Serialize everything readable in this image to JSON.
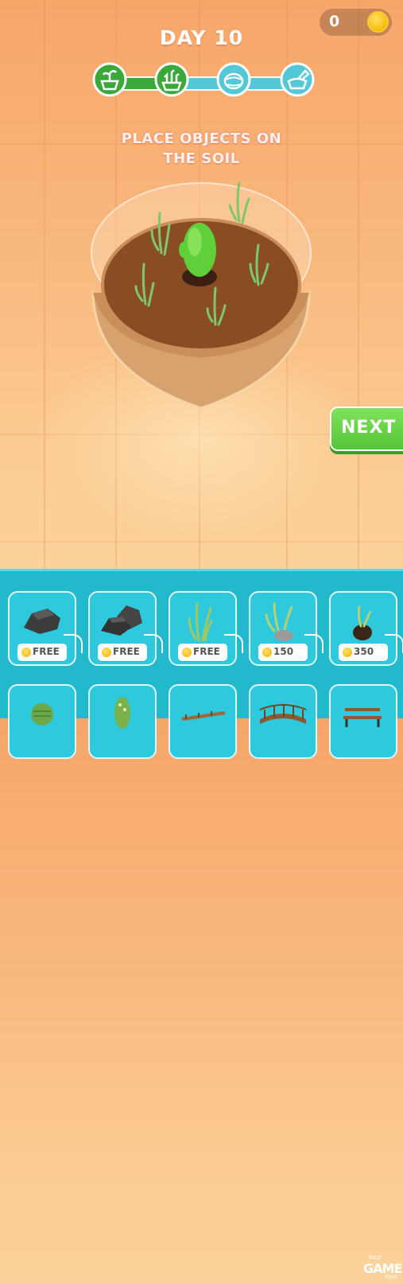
{
  "hud": {
    "coins": "0",
    "day_title": "DAY 10"
  },
  "progress": {
    "stages": [
      "plant-pot-icon",
      "seedling-icon",
      "terrarium-icon",
      "decorate-icon"
    ],
    "completed_fraction": 0.33,
    "colors": {
      "done": "#3aa83a",
      "pending": "#55c8d8"
    }
  },
  "instruction": {
    "line1": "PLACE OBJECTS ON",
    "line2": "THE SOIL"
  },
  "next_button": {
    "label": "NEXT"
  },
  "shop": {
    "items": [
      {
        "name": "rock-small",
        "price": "FREE"
      },
      {
        "name": "rock-double",
        "price": "FREE"
      },
      {
        "name": "grass-tuft",
        "price": "FREE"
      },
      {
        "name": "grass-with-stone",
        "price": "150"
      },
      {
        "name": "potted-sprout",
        "price": "350"
      },
      {
        "name": "round-cactus",
        "price": ""
      },
      {
        "name": "tall-cactus",
        "price": ""
      },
      {
        "name": "small-bridge",
        "price": ""
      },
      {
        "name": "wooden-bridge",
        "price": ""
      },
      {
        "name": "park-bench",
        "price": ""
      }
    ]
  },
  "watermark": {
    "top": "Your",
    "main": "GAME",
    "bottom": "toys"
  }
}
